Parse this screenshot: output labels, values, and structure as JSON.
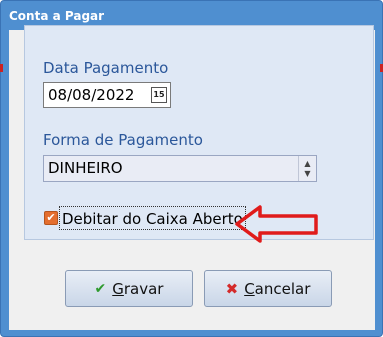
{
  "window": {
    "title": "Conta a Pagar"
  },
  "form": {
    "date_label": "Data Pagamento",
    "date_value": "08/08/2022",
    "payment_label": "Forma de Pagamento",
    "payment_value": "DINHEIRO",
    "debit_checkbox_label": "Debitar do Caixa Aberto",
    "debit_checked": true
  },
  "buttons": {
    "save_accel": "G",
    "save_rest": "ravar",
    "cancel_accel": "C",
    "cancel_rest": "ancelar"
  },
  "colors": {
    "title_bar": "#4f8fd0",
    "accent_label": "#2b579a",
    "checkbox": "#e46e2f",
    "arrow": "#e01b1b"
  },
  "icons": [
    "calendar-icon",
    "spinner-icon",
    "checkmark-icon",
    "cancel-x-icon",
    "red-arrow-icon"
  ]
}
